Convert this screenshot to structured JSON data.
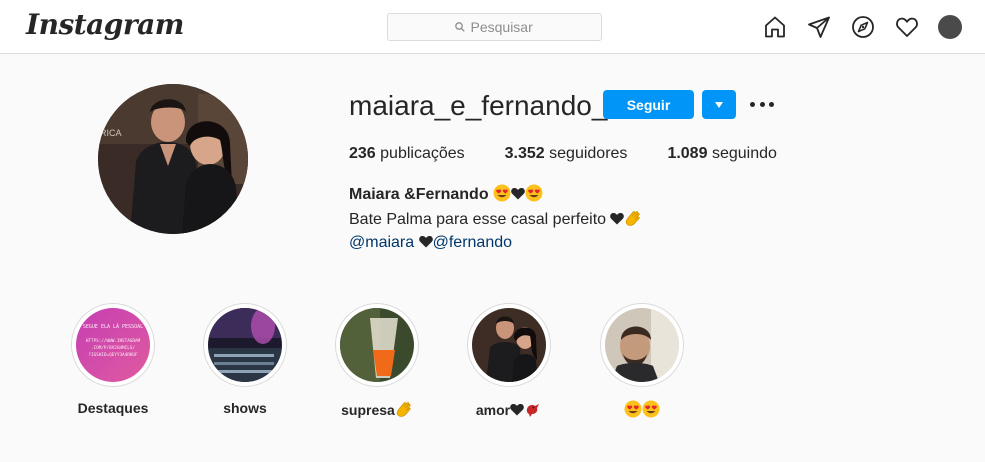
{
  "header": {
    "logo_text": "Instagram",
    "search_placeholder": "Pesquisar",
    "icons": [
      "home-icon",
      "direct-icon",
      "explore-icon",
      "activity-icon",
      "profile-avatar"
    ]
  },
  "profile": {
    "username": "maiara_e_fernando_",
    "follow_label": "Seguir",
    "stats": [
      {
        "count": "236",
        "label": "publicações"
      },
      {
        "count": "3.352",
        "label": "seguidores"
      },
      {
        "count": "1.089",
        "label": "seguindo"
      }
    ],
    "full_name": "Maiara &Fernando",
    "bio_line": "Bate Palma para esse casal perfeito",
    "mention_1": "@maiara",
    "mention_2": "@fernando"
  },
  "highlights": [
    {
      "label": "Destaques",
      "image_text": [
        "SEGUE ELA LÁ PESSOAL",
        "HTTPS://WWW.INSTAGRAM",
        ".COM/P/BV2GHMCLS/",
        "?IGSHID=QEYY3A4RKUF"
      ]
    },
    {
      "label": "shows"
    },
    {
      "label": "supresa"
    },
    {
      "label": "amor"
    },
    {
      "label": ""
    }
  ],
  "colors": {
    "accent": "#0095f6",
    "link": "#00376b",
    "text": "#262626",
    "background": "#fafafa",
    "border": "#dbdbdb"
  }
}
